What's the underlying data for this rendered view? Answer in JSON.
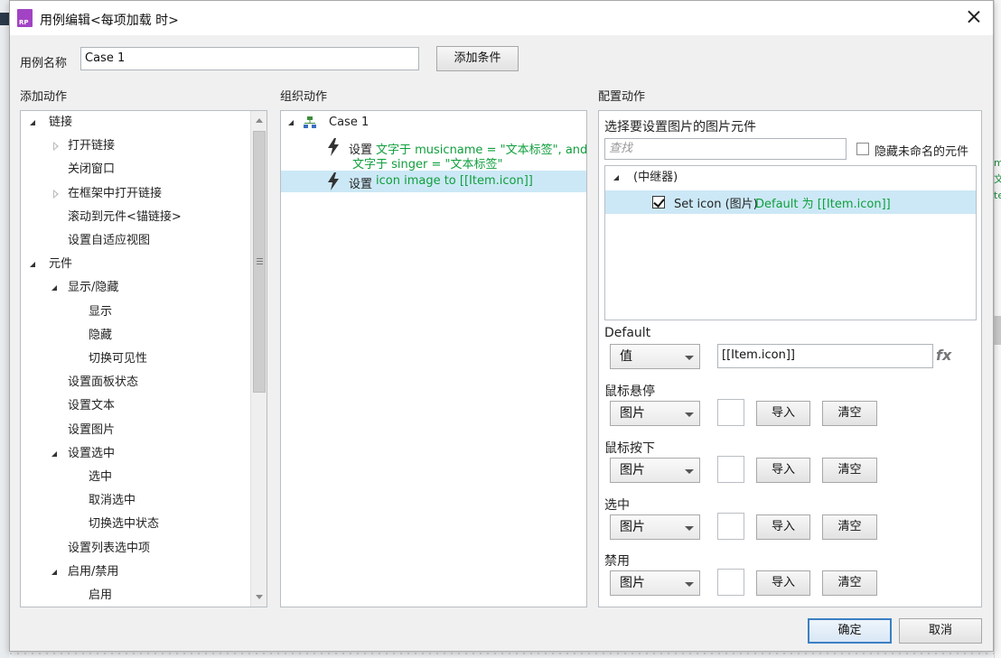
{
  "window": {
    "title": "用例编辑<每项加载 时>",
    "app_icon_text": "RP"
  },
  "header": {
    "case_name_label": "用例名称",
    "case_name_value": "Case 1",
    "add_condition_button": "添加条件"
  },
  "sections": {
    "add_action": "添加动作",
    "organize_action": "组织动作",
    "configure_action": "配置动作"
  },
  "actions_tree": [
    {
      "label": "链接",
      "level": 0,
      "state": "expanded"
    },
    {
      "label": "打开链接",
      "level": 1,
      "state": "collapsed"
    },
    {
      "label": "关闭窗口",
      "level": 1,
      "state": "leaf"
    },
    {
      "label": "在框架中打开链接",
      "level": 1,
      "state": "collapsed"
    },
    {
      "label": "滚动到元件<锚链接>",
      "level": 1,
      "state": "leaf"
    },
    {
      "label": "设置自适应视图",
      "level": 1,
      "state": "leaf"
    },
    {
      "label": "元件",
      "level": 0,
      "state": "expanded"
    },
    {
      "label": "显示/隐藏",
      "level": 1,
      "state": "expanded"
    },
    {
      "label": "显示",
      "level": 2,
      "state": "leaf"
    },
    {
      "label": "隐藏",
      "level": 2,
      "state": "leaf"
    },
    {
      "label": "切换可见性",
      "level": 2,
      "state": "leaf"
    },
    {
      "label": "设置面板状态",
      "level": 1,
      "state": "leaf"
    },
    {
      "label": "设置文本",
      "level": 1,
      "state": "leaf"
    },
    {
      "label": "设置图片",
      "level": 1,
      "state": "leaf"
    },
    {
      "label": "设置选中",
      "level": 1,
      "state": "expanded"
    },
    {
      "label": "选中",
      "level": 2,
      "state": "leaf"
    },
    {
      "label": "取消选中",
      "level": 2,
      "state": "leaf"
    },
    {
      "label": "切换选中状态",
      "level": 2,
      "state": "leaf"
    },
    {
      "label": "设置列表选中项",
      "level": 1,
      "state": "leaf"
    },
    {
      "label": "启用/禁用",
      "level": 1,
      "state": "expanded"
    },
    {
      "label": "启用",
      "level": 2,
      "state": "leaf"
    }
  ],
  "organize": {
    "case_label": "Case 1",
    "action1": {
      "prefix": "设置",
      "line1": "文字于 musicname = \"文本标签\", and",
      "line2": "文字于 singer = \"文本标签\""
    },
    "action2": {
      "prefix": "设置",
      "detail": "icon image to [[Item.icon]]"
    }
  },
  "configure": {
    "select_title": "选择要设置图片的图片元件",
    "search_placeholder": "查找",
    "hide_unnamed_label": "隐藏未命名的元件",
    "hide_unnamed_checked": false,
    "widget_tree": {
      "repeater_label": "(中继器)",
      "item_name": "Set icon (图片)",
      "item_detail": "Default 为 [[Item.icon]]",
      "item_checked": true
    },
    "states": [
      {
        "label": "Default",
        "type": "值",
        "value": "[[Item.icon]]",
        "fx": "fx"
      },
      {
        "label": "鼠标悬停",
        "type": "图片",
        "import": "导入",
        "clear": "清空"
      },
      {
        "label": "鼠标按下",
        "type": "图片",
        "import": "导入",
        "clear": "清空"
      },
      {
        "label": "选中",
        "type": "图片",
        "import": "导入",
        "clear": "清空"
      },
      {
        "label": "禁用",
        "type": "图片",
        "import": "导入",
        "clear": "清空"
      }
    ]
  },
  "footer": {
    "ok_button": "确定",
    "cancel_button": "取消"
  },
  "background_fragments": {
    "right_edge_1": "m",
    "right_edge_2": "文",
    "right_edge_3": "te"
  },
  "colors": {
    "selection": "#cce8f6",
    "green_text": "#0f9f3c",
    "accent_border": "#3c7fc3",
    "app_icon": "#a243c4"
  }
}
